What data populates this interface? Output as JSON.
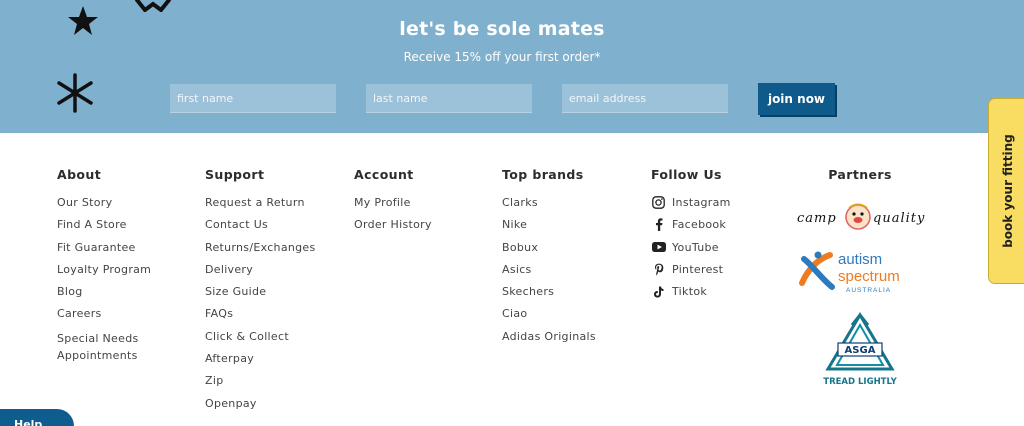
{
  "newsletter": {
    "title": "let's be sole mates",
    "subtitle": "Receive 15% off your first order*",
    "first_name_placeholder": "first name",
    "last_name_placeholder": "last name",
    "email_placeholder": "email address",
    "join_label": "join now"
  },
  "about": {
    "heading": "About",
    "items": [
      "Our Story",
      "Find A Store",
      "Fit Guarantee",
      "Loyalty Program",
      "Blog",
      "Careers",
      "Special Needs Appointments"
    ]
  },
  "support": {
    "heading": "Support",
    "items": [
      "Request a Return",
      "Contact Us",
      "Returns/Exchanges",
      "Delivery",
      "Size Guide",
      "FAQs",
      "Click & Collect",
      "Afterpay",
      "Zip",
      "Openpay"
    ]
  },
  "account": {
    "heading": "Account",
    "items": [
      "My Profile",
      "Order History"
    ]
  },
  "brands": {
    "heading": "Top brands",
    "items": [
      "Clarks",
      "Nike",
      "Bobux",
      "Asics",
      "Skechers",
      "Ciao",
      "Adidas Originals"
    ]
  },
  "follow": {
    "heading": "Follow Us",
    "items": [
      {
        "label": "Instagram",
        "icon": "instagram-icon"
      },
      {
        "label": "Facebook",
        "icon": "facebook-icon"
      },
      {
        "label": "YouTube",
        "icon": "youtube-icon"
      },
      {
        "label": "Pinterest",
        "icon": "pinterest-icon"
      },
      {
        "label": "Tiktok",
        "icon": "tiktok-icon"
      }
    ]
  },
  "partners": {
    "heading": "Partners",
    "camp_quality": {
      "left": "camp",
      "right": "quality."
    },
    "autism": {
      "line1": "autism",
      "line2": "spectrum",
      "line3": "AUSTRALIA"
    },
    "asga": {
      "badge": "ASGA",
      "tagline": "TREAD LIGHTLY"
    }
  },
  "side_tab": {
    "label": "book your fitting"
  },
  "help": {
    "label": "Help"
  },
  "colors": {
    "band": "#7fb0cd",
    "button": "#0e5a8a",
    "tab": "#f8dd62"
  }
}
